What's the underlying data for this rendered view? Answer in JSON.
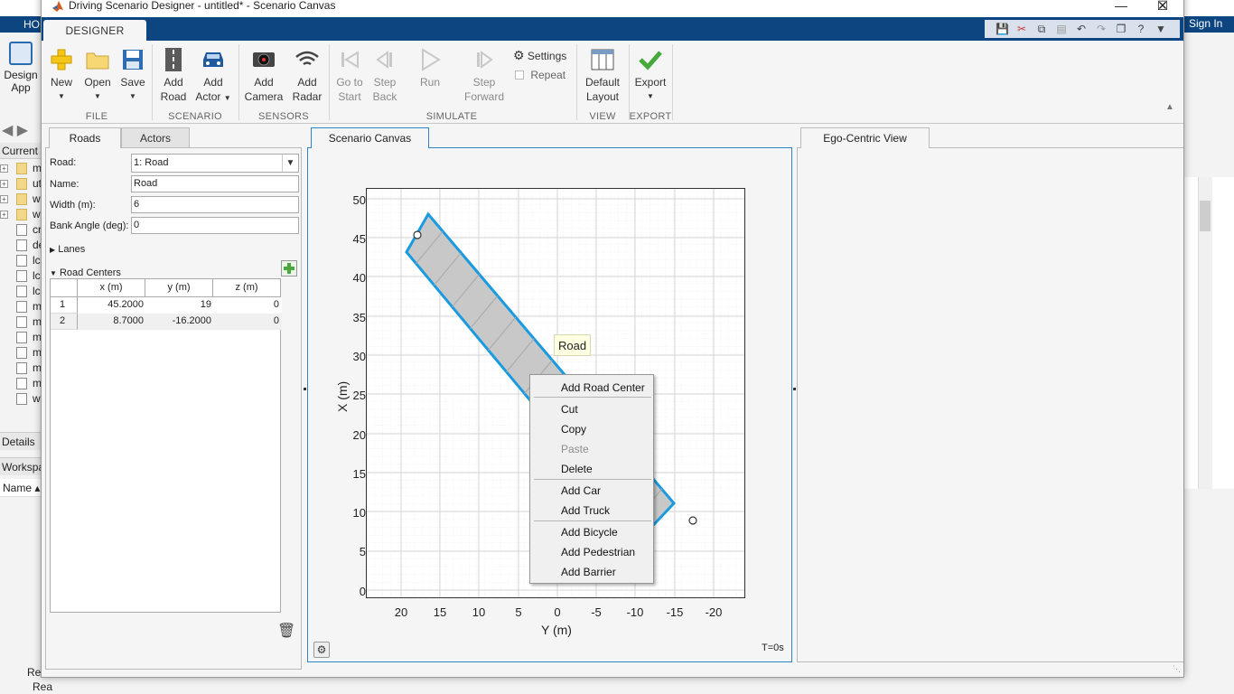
{
  "background": {
    "home_tab": "HO",
    "sign_in": "Sign In",
    "design_app": [
      "Design",
      "App"
    ],
    "current_folder": "Current",
    "files": [
      {
        "type": "folder",
        "name": "m",
        "expandable": true
      },
      {
        "type": "folder",
        "name": "ut",
        "expandable": true
      },
      {
        "type": "folder",
        "name": "w",
        "expandable": true
      },
      {
        "type": "folder",
        "name": "w",
        "expandable": true
      },
      {
        "type": "file",
        "name": "cr",
        "expandable": false
      },
      {
        "type": "model",
        "name": "de",
        "expandable": false
      },
      {
        "type": "file",
        "name": "lc",
        "expandable": false
      },
      {
        "type": "file",
        "name": "lc",
        "expandable": false
      },
      {
        "type": "file",
        "name": "lc",
        "expandable": false
      },
      {
        "type": "mfile",
        "name": "m",
        "expandable": false
      },
      {
        "type": "model",
        "name": "m",
        "expandable": false
      },
      {
        "type": "model",
        "name": "m",
        "expandable": false
      },
      {
        "type": "model",
        "name": "m",
        "expandable": false
      },
      {
        "type": "model",
        "name": "m",
        "expandable": false
      },
      {
        "type": "model",
        "name": "m",
        "expandable": false
      },
      {
        "type": "model",
        "name": "w",
        "expandable": false
      }
    ],
    "details": "Details",
    "workspace": "Workspa",
    "name_col": "Name ▴",
    "status_ready_1": "Rea",
    "status_ready_2": "Rea"
  },
  "window": {
    "title": "Driving Scenario Designer - untitled* - Scenario Canvas",
    "controls": {
      "minimize": "—",
      "maximize": "☐",
      "close": "✕"
    }
  },
  "toolstrip": {
    "tab_label": "DESIGNER",
    "groups": {
      "file": "FILE",
      "scenario": "SCENARIO",
      "sensors": "SENSORS",
      "simulate": "SIMULATE",
      "view": "VIEW",
      "export": "EXPORT"
    },
    "new": {
      "label": "New"
    },
    "open": {
      "label": "Open"
    },
    "save": {
      "label": "Save"
    },
    "add_road": {
      "line1": "Add",
      "line2": "Road"
    },
    "add_actor": {
      "line1": "Add",
      "line2": "Actor"
    },
    "add_camera": {
      "line1": "Add",
      "line2": "Camera"
    },
    "add_radar": {
      "line1": "Add",
      "line2": "Radar"
    },
    "go_to_start": {
      "line1": "Go to",
      "line2": "Start"
    },
    "step_back": {
      "line1": "Step",
      "line2": "Back"
    },
    "run": {
      "label": "Run"
    },
    "step_forward": {
      "line1": "Step",
      "line2": "Forward"
    },
    "settings": "Settings",
    "repeat": "Repeat",
    "default_layout": {
      "line1": "Default",
      "line2": "Layout"
    },
    "export": {
      "label": "Export"
    }
  },
  "left_panel": {
    "tabs": [
      "Roads",
      "Actors"
    ],
    "road_label": "Road:",
    "road_selected": "1: Road",
    "name_label": "Name:",
    "name_value": "Road",
    "width_label": "Width (m):",
    "width_value": "6",
    "bank_label": "Bank Angle (deg):",
    "bank_value": "0",
    "lanes_section": "Lanes",
    "road_centers_section": "Road Centers",
    "table": {
      "headers": [
        "x (m)",
        "y (m)",
        "z (m)"
      ],
      "rows": [
        {
          "num": "1",
          "x": "45.2000",
          "y": "19",
          "z": "0"
        },
        {
          "num": "2",
          "x": "8.7000",
          "y": "-16.2000",
          "z": "0"
        }
      ]
    }
  },
  "canvas": {
    "tab_label": "Scenario Canvas",
    "time": "T=0s",
    "y_axis_title": "X (m)",
    "x_axis_title": "Y (m)",
    "y_ticks": [
      "50",
      "45",
      "40",
      "35",
      "30",
      "25",
      "20",
      "15",
      "10",
      "5",
      "0"
    ],
    "x_ticks": [
      "20",
      "15",
      "10",
      "5",
      "0",
      "-5",
      "-10",
      "-15",
      "-20"
    ],
    "road_tooltip": "Road",
    "road_color": "#c8c8c8",
    "road_outline_color": "#1a9be0"
  },
  "context_menu": {
    "items": [
      {
        "label": "Add Road Center",
        "enabled": true
      },
      {
        "label": "Cut",
        "enabled": true
      },
      {
        "label": "Copy",
        "enabled": true
      },
      {
        "label": "Paste",
        "enabled": false
      },
      {
        "label": "Delete",
        "enabled": true
      },
      {
        "label": "Add Car",
        "enabled": true
      },
      {
        "label": "Add Truck",
        "enabled": true
      },
      {
        "label": "Add Bicycle",
        "enabled": true
      },
      {
        "label": "Add Pedestrian",
        "enabled": true
      },
      {
        "label": "Add Barrier",
        "enabled": true
      }
    ]
  },
  "ego_view": {
    "tab_label": "Ego-Centric View"
  },
  "colors": {
    "brand_blue": "#0c4580",
    "accent_blue": "#2b86c9",
    "add_green": "#47a83c"
  }
}
